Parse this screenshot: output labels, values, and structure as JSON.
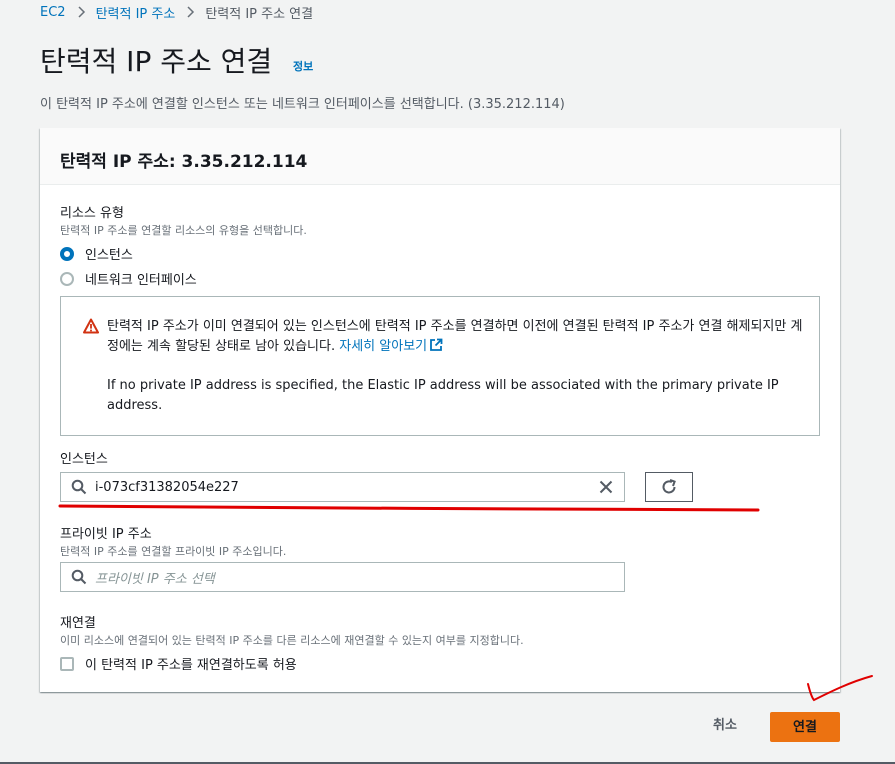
{
  "breadcrumb": {
    "items": [
      "EC2",
      "탄력적 IP 주소",
      "탄력적 IP 주소 연결"
    ]
  },
  "page": {
    "title": "탄력적 IP 주소 연결",
    "info_link": "정보",
    "description": "이 탄력적 IP 주소에 연결할 인스턴스 또는 네트워크 인터페이스를 선택합니다. (3.35.212.114)"
  },
  "panel": {
    "title": "탄력적 IP 주소: 3.35.212.114",
    "resource_type": {
      "label": "리소스 유형",
      "description": "탄력적 IP 주소를 연결할 리소스의 유형을 선택합니다.",
      "options": [
        "인스턴스",
        "네트워크 인터페이스"
      ],
      "selected": "인스턴스"
    },
    "alert": {
      "text": "탄력적 IP 주소가 이미 연결되어 있는 인스턴스에 탄력적 IP 주소를 연결하면 이전에 연결된 탄력적 IP 주소가 연결 해제되지만 계정에는 계속 할당된 상태로 남아 있습니다.",
      "link": "자세히 알아보기",
      "text2": "If no private IP address is specified, the Elastic IP address will be associated with the primary private IP address."
    },
    "instance": {
      "label": "인스턴스",
      "value": "i-073cf31382054e227"
    },
    "private_ip": {
      "label": "프라이빗 IP 주소",
      "description": "탄력적 IP 주소를 연결할 프라이빗 IP 주소입니다.",
      "placeholder": "프라이빗 IP 주소 선택"
    },
    "reassociation": {
      "label": "재연결",
      "description": "이미 리소스에 연결되어 있는 탄력적 IP 주소를 다른 리소스에 재연결할 수 있는지 여부를 지정합니다.",
      "checkbox_label": "이 탄력적 IP 주소를 재연결하도록 허용"
    }
  },
  "actions": {
    "cancel": "취소",
    "connect": "연결"
  },
  "colors": {
    "accent": "#0073bb",
    "primary_button": "#ec7211",
    "annotation": "#e00000"
  }
}
